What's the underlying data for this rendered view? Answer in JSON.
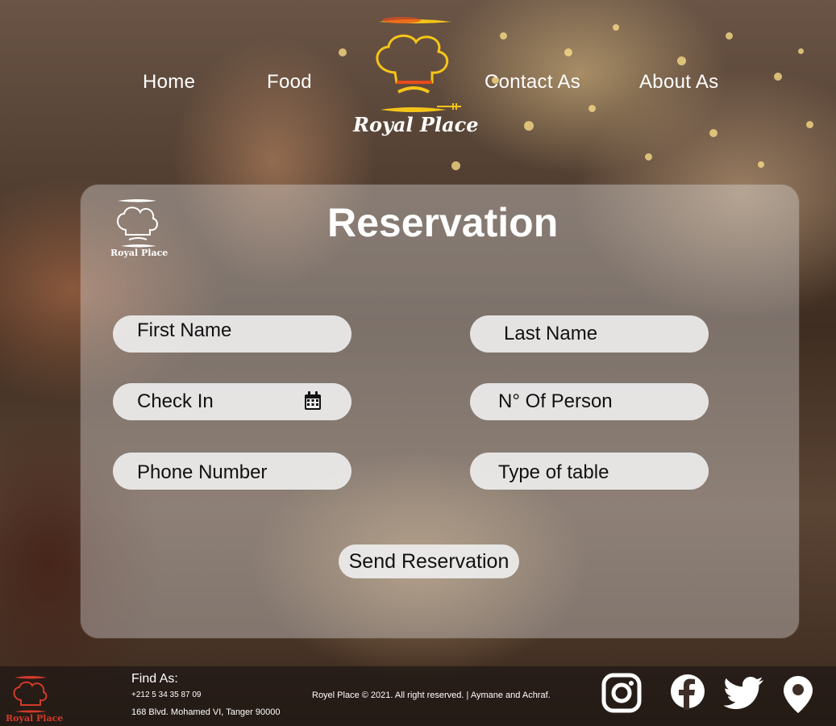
{
  "nav": {
    "home": "Home",
    "food": "Food",
    "contact": "Contact As",
    "about": "About As"
  },
  "brand": {
    "name": "Royal Place"
  },
  "form": {
    "title": "Reservation",
    "first_name": "First Name",
    "last_name": "Last Name",
    "check_in": "Check In",
    "persons": "N° Of Person",
    "phone": "Phone Number",
    "table_type": "Type of table",
    "submit": "Send Reservation"
  },
  "footer": {
    "find_label": "Find As:",
    "phone": "+212 5 34 35 87 09",
    "address": "168 Blvd. Mohamed VI, Tanger 90000",
    "copyright": "Royel Place  © 2021. All right reserved. | Aymane and Achraf."
  },
  "icons": {
    "calendar": "calendar-icon",
    "instagram": "instagram-icon",
    "facebook": "facebook-icon",
    "twitter": "twitter-icon",
    "location": "location-pin-icon"
  },
  "colors": {
    "panel": "#e1e1e1",
    "field": "#f0f0f0",
    "logo_gold": "#f5c518",
    "logo_red": "#d23a2a",
    "text": "#ffffff"
  }
}
